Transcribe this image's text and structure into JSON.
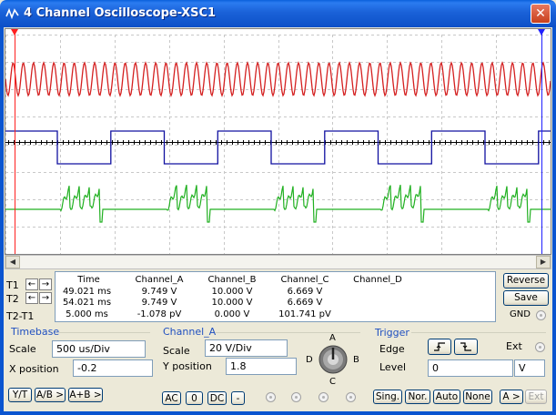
{
  "window": {
    "title": "4 Channel Oscilloscope-XSC1",
    "close_label": "✕"
  },
  "colors": {
    "channel_a": "#d42020",
    "channel_b": "#1010a0",
    "channel_c": "#20b020",
    "grid": "#c8c8c8",
    "cursor_t1": "#ff2020",
    "cursor_t2": "#2020ff"
  },
  "cursors": {
    "t1_marker": "T1",
    "t2_marker": "T2"
  },
  "readout": {
    "headers": [
      "Time",
      "Channel_A",
      "Channel_B",
      "Channel_C",
      "Channel_D"
    ],
    "row_labels": [
      "T1",
      "T2",
      "T2-T1"
    ],
    "rows": [
      [
        "49.021 ms",
        "9.749 V",
        "10.000 V",
        "6.669 V",
        ""
      ],
      [
        "54.021 ms",
        "9.749 V",
        "10.000 V",
        "6.669 V",
        ""
      ],
      [
        "5.000 ms",
        "-1.078 pV",
        "0.000 V",
        "101.741 pV",
        ""
      ]
    ]
  },
  "side_buttons": {
    "reverse": "Reverse",
    "save": "Save",
    "gnd": "GND"
  },
  "timebase": {
    "title": "Timebase",
    "scale_label": "Scale",
    "scale_value": "500 us/Div",
    "xpos_label": "X position",
    "xpos_value": "-0.2",
    "modes": [
      "Y/T",
      "A/B >",
      "A+B >"
    ]
  },
  "channel_a": {
    "title": "Channel_A",
    "scale_label": "Scale",
    "scale_value": "20  V/Div",
    "ypos_label": "Y position",
    "ypos_value": "1.8",
    "coupling": [
      "AC",
      "0",
      "DC",
      "-"
    ],
    "knob": {
      "a": "A",
      "b": "B",
      "c": "C",
      "d": "D"
    }
  },
  "trigger": {
    "title": "Trigger",
    "edge_label": "Edge",
    "level_label": "Level",
    "level_value": "0",
    "level_unit": "V",
    "ext_label": "Ext",
    "modes": [
      "Sing.",
      "Nor.",
      "Auto",
      "None"
    ],
    "source": [
      "A >",
      "Ext"
    ]
  }
}
